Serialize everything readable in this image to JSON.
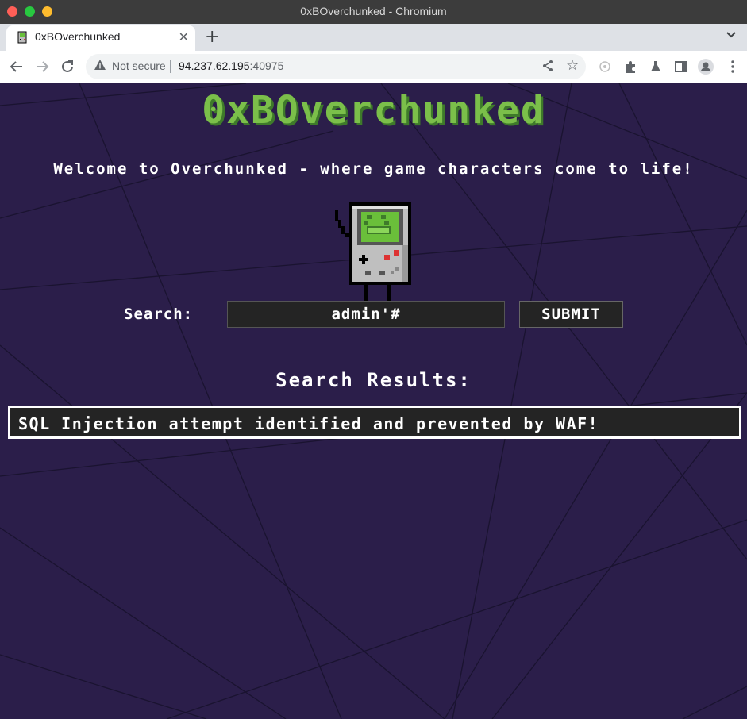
{
  "window": {
    "title": "0xBOverchunked - Chromium"
  },
  "tab": {
    "title": "0xBOverchunked",
    "close_glyph": "✕",
    "new_glyph": "+"
  },
  "toolbar": {
    "security_label": "Not secure",
    "url_host": "94.237.62.195",
    "url_port": ":40975"
  },
  "page": {
    "logo": "0xBOverchunked",
    "welcome": "Welcome to Overchunked - where game characters come to life!",
    "search_label": "Search:",
    "search_value": "admin'#",
    "submit_label": "SUBMIT",
    "results_title": "Search Results:",
    "result_message": "SQL Injection attempt identified and prevented by WAF!"
  },
  "colors": {
    "background": "#2b1e4a",
    "logo_green": "#7bbf4a",
    "box_dark": "#242424"
  },
  "icons": [
    "back-icon",
    "forward-icon",
    "reload-icon",
    "warning-icon",
    "share-icon",
    "star-icon",
    "extension-icon",
    "puzzle-icon",
    "flask-icon",
    "sidepanel-icon",
    "profile-icon",
    "menu-icon"
  ]
}
